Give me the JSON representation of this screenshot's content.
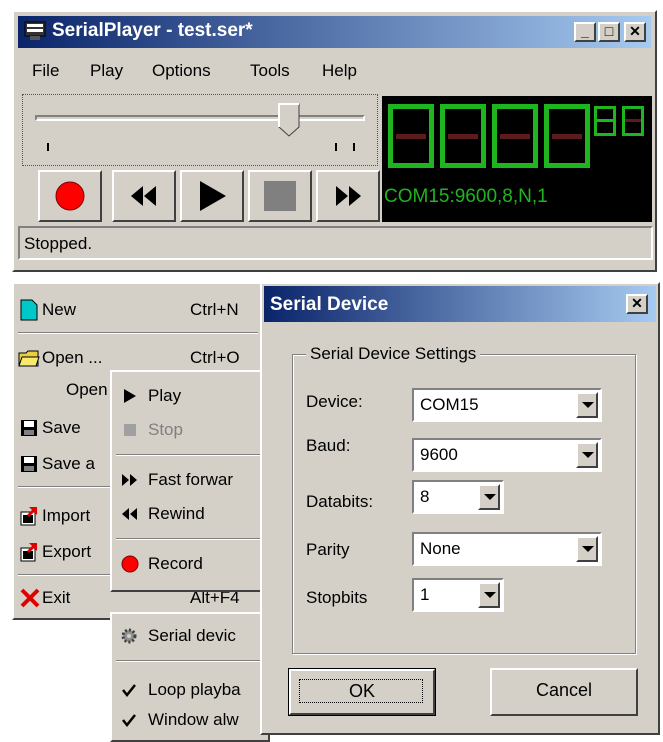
{
  "main_window": {
    "title": "SerialPlayer - test.ser*",
    "menu": [
      "File",
      "Play",
      "Options",
      "Tools",
      "Help"
    ],
    "status": "Stopped.",
    "lcd_port": "COM15:9600,8,N,1",
    "slider_position": 0.77
  },
  "file_menu": {
    "items": [
      {
        "label": "New",
        "shortcut": "Ctrl+N"
      },
      {
        "label": "Open ...",
        "shortcut": "Ctrl+O"
      },
      {
        "label": "Open"
      },
      {
        "label": "Save"
      },
      {
        "label": "Save a"
      },
      {
        "label": "Import"
      },
      {
        "label": "Export"
      },
      {
        "label": "Exit",
        "shortcut": "Alt+F4"
      }
    ]
  },
  "play_menu": {
    "items": [
      {
        "label": "Play"
      },
      {
        "label": "Stop"
      },
      {
        "label": "Fast forwar"
      },
      {
        "label": "Rewind"
      },
      {
        "label": "Record"
      }
    ]
  },
  "options_menu": {
    "items": [
      {
        "label": "Serial devic"
      },
      {
        "label": "Loop playba"
      },
      {
        "label": "Window alw"
      }
    ]
  },
  "dialog": {
    "title": "Serial Device",
    "group_label": "Serial Device Settings",
    "fields": [
      {
        "label": "Device:",
        "value": "COM15"
      },
      {
        "label": "Baud:",
        "value": "9600"
      },
      {
        "label": "Databits:",
        "value": "8"
      },
      {
        "label": "Parity",
        "value": "None"
      },
      {
        "label": "Stopbits",
        "value": "1"
      }
    ],
    "ok_label": "OK",
    "cancel_label": "Cancel"
  },
  "colors": {
    "lcd_green": "#1fb51f",
    "lcd_dark": "#4a1a1a",
    "record_red": "#ff0000"
  }
}
